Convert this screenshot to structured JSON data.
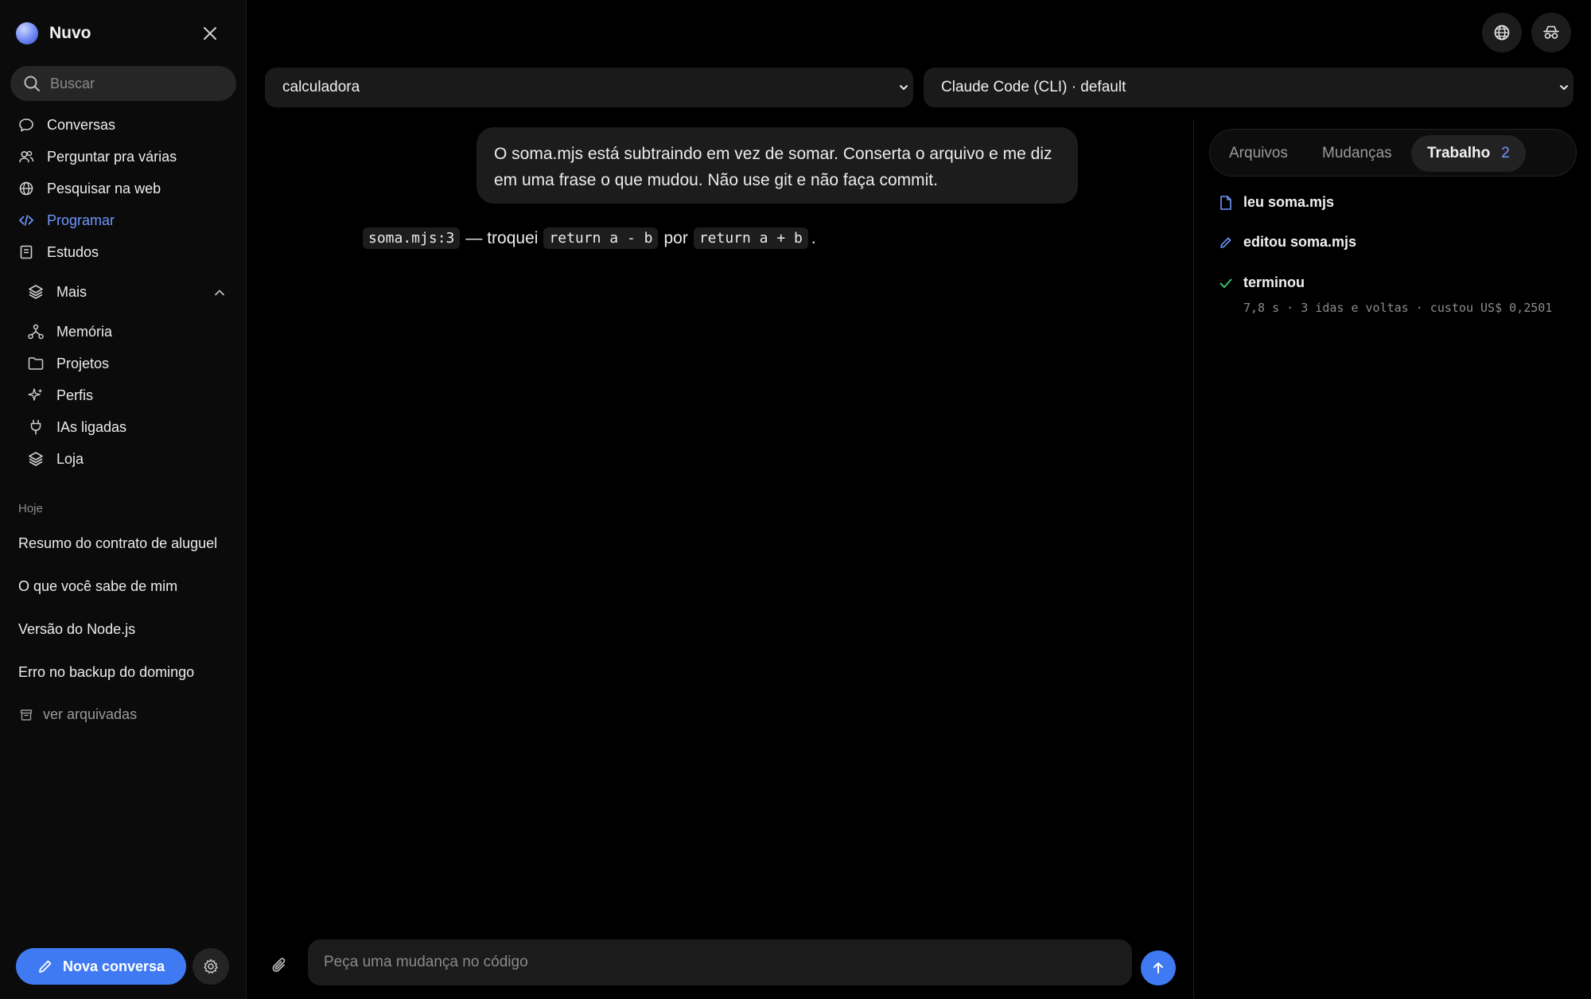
{
  "app": {
    "name": "Nuvo"
  },
  "search": {
    "placeholder": "Buscar"
  },
  "nav": {
    "items": [
      {
        "label": "Conversas",
        "icon": "chat-bubble-icon"
      },
      {
        "label": "Perguntar pra várias",
        "icon": "users-icon"
      },
      {
        "label": "Pesquisar na web",
        "icon": "globe-icon"
      },
      {
        "label": "Programar",
        "icon": "code-icon",
        "active": true
      },
      {
        "label": "Estudos",
        "icon": "notebook-icon"
      }
    ],
    "more": {
      "label": "Mais",
      "expanded": true,
      "items": [
        {
          "label": "Memória",
          "icon": "network-icon"
        },
        {
          "label": "Projetos",
          "icon": "folder-icon"
        },
        {
          "label": "Perfis",
          "icon": "sparkle-icon"
        },
        {
          "label": "IAs ligadas",
          "icon": "plug-icon"
        },
        {
          "label": "Loja",
          "icon": "layers-icon"
        }
      ]
    }
  },
  "history": {
    "section": "Hoje",
    "items": [
      "Resumo do contrato de aluguel",
      "O que você sabe de mim",
      "Versão do Node.js",
      "Erro no backup do domingo"
    ],
    "archived_label": "ver arquivadas"
  },
  "footer": {
    "new_conversation": "Nova conversa"
  },
  "selects": {
    "project": "calculadora",
    "agent": "Claude Code (CLI) · default"
  },
  "chat": {
    "user_message": "O soma.mjs está subtraindo em vez de somar. Conserta o arquivo e me diz em uma frase o que mudou. Não use git e não faça commit.",
    "reply": {
      "code_ref": "soma.mjs:3",
      "text_1": "— troquei",
      "code_old": "return a - b",
      "text_2": "por",
      "code_new": "return a + b",
      "text_3": "."
    }
  },
  "composer": {
    "placeholder": "Peça uma mudança no código"
  },
  "panel": {
    "tabs": [
      {
        "label": "Arquivos"
      },
      {
        "label": "Mudanças"
      },
      {
        "label": "Trabalho",
        "badge": "2",
        "active": true
      }
    ],
    "activity": [
      {
        "label": "leu soma.mjs",
        "icon": "file-icon"
      },
      {
        "label": "editou soma.mjs",
        "icon": "pencil-icon"
      },
      {
        "label": "terminou",
        "icon": "check-icon",
        "meta": "7,8 s · 3 idas e voltas · custou US$ 0,2501"
      }
    ]
  },
  "colors": {
    "accent": "#3f7af2",
    "accent_text": "#6f97ff",
    "success": "#3fbf6f",
    "background": "#000000"
  }
}
